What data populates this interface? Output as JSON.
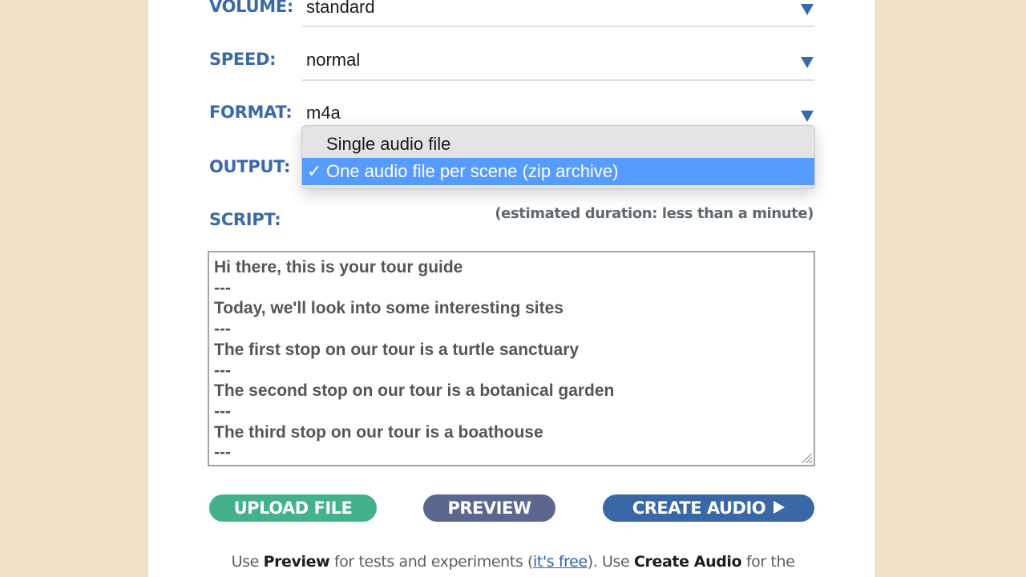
{
  "form": {
    "volume": {
      "label": "VOLUME:",
      "value": "standard"
    },
    "speed": {
      "label": "SPEED:",
      "value": "normal"
    },
    "format": {
      "label": "FORMAT:",
      "value": "m4a"
    },
    "output": {
      "label": "OUTPUT:",
      "options": [
        {
          "label": "Single audio file",
          "selected": false
        },
        {
          "label": "One audio file per scene (zip archive)",
          "selected": true
        }
      ],
      "check_glyph": "✓"
    },
    "script": {
      "label": "SCRIPT:",
      "duration": "(estimated duration: less than a minute)",
      "lines": [
        "Hi there, this is your tour guide",
        "---",
        "Today, we'll look into some interesting sites",
        "---",
        "The first stop on our tour is a turtle sanctuary",
        "---",
        "The second stop on our tour is a botanical garden",
        "---",
        "The third stop on our tour is a boathouse",
        "---"
      ]
    }
  },
  "buttons": {
    "upload": "UPLOAD FILE",
    "preview": "PREVIEW",
    "create": "CREATE AUDIO"
  },
  "footer": {
    "t1": "Use ",
    "b1": "Preview",
    "t2": " for tests and experiments (",
    "link": "it's free",
    "t3": "). Use ",
    "b2": "Create Audio",
    "t4": " for the"
  },
  "colors": {
    "label_blue": "#3a69a8",
    "upload_green": "#43b18c",
    "preview_slate": "#5c6790",
    "create_blue": "#3a68a6",
    "highlight": "#569cff",
    "background": "#f0e1c6"
  }
}
